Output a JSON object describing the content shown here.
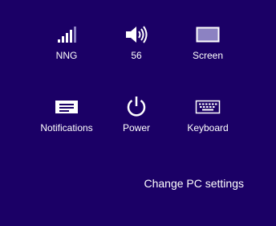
{
  "quick_settings": {
    "network": {
      "label": "NNG",
      "icon": "wifi-signal-icon"
    },
    "volume": {
      "label": "56",
      "icon": "speaker-icon"
    },
    "screen": {
      "label": "Screen",
      "icon": "screen-icon"
    },
    "notifications": {
      "label": "Notifications",
      "icon": "notifications-icon"
    },
    "power": {
      "label": "Power",
      "icon": "power-icon"
    },
    "keyboard": {
      "label": "Keyboard",
      "icon": "keyboard-icon"
    }
  },
  "links": {
    "change_pc_settings": "Change PC settings"
  },
  "colors": {
    "background": "#1b0066",
    "foreground": "#ffffff",
    "screen_fill": "#8c82c2"
  }
}
